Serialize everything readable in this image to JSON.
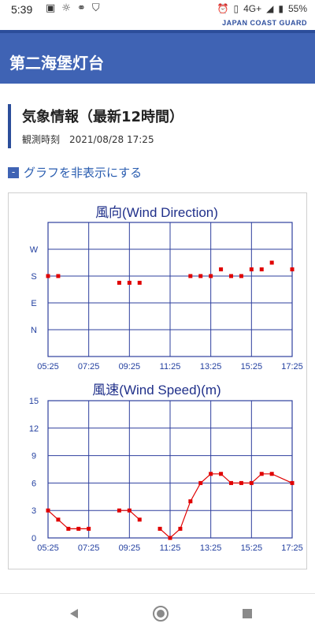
{
  "status_bar": {
    "time": "5:39",
    "network": "4G+",
    "battery": "55%",
    "icons": [
      "image-icon",
      "bulb-icon",
      "link-icon",
      "shield-icon",
      "alarm-icon",
      "vibrate-icon",
      "signal-icon",
      "battery-icon"
    ]
  },
  "header": {
    "org_text": "JAPAN COAST GUARD",
    "title": "第二海堡灯台",
    "colors": {
      "bar": "#3f63b4",
      "accent": "#2b4d9a"
    }
  },
  "section": {
    "title": "気象情報（最新12時間）",
    "obs_label": "観測時刻",
    "obs_time": "2021/08/28 17:25"
  },
  "toggle": {
    "box": "-",
    "label": "グラフを非表示にする"
  },
  "chart_data": [
    {
      "type": "scatter",
      "title": "風向(Wind Direction)",
      "x_ticks": [
        "05:25",
        "07:25",
        "09:25",
        "11:25",
        "13:25",
        "15:25",
        "17:25"
      ],
      "y_ticks": [
        "N",
        "E",
        "S",
        "W"
      ],
      "xlim": [
        0,
        12
      ],
      "ylim": [
        -1,
        4
      ],
      "y_scale": "N=0, E=1, S=2, W=3 (16-point, 0.25 per step)",
      "points": [
        {
          "x": 0.0,
          "y": 2.0
        },
        {
          "x": 0.5,
          "y": 2.0
        },
        {
          "x": 3.5,
          "y": 1.75
        },
        {
          "x": 4.0,
          "y": 1.75
        },
        {
          "x": 4.5,
          "y": 1.75
        },
        {
          "x": 7.0,
          "y": 2.0
        },
        {
          "x": 7.5,
          "y": 2.0
        },
        {
          "x": 8.0,
          "y": 2.0
        },
        {
          "x": 8.5,
          "y": 2.25
        },
        {
          "x": 9.0,
          "y": 2.0
        },
        {
          "x": 9.5,
          "y": 2.0
        },
        {
          "x": 10.0,
          "y": 2.25
        },
        {
          "x": 10.5,
          "y": 2.25
        },
        {
          "x": 11.0,
          "y": 2.5
        },
        {
          "x": 12.0,
          "y": 2.25
        }
      ],
      "color": "#e00000",
      "grid": true
    },
    {
      "type": "line",
      "title": "風速(Wind Speed)(m)",
      "x_ticks": [
        "05:25",
        "07:25",
        "09:25",
        "11:25",
        "13:25",
        "15:25",
        "17:25"
      ],
      "y_ticks": [
        "0",
        "3",
        "6",
        "9",
        "12",
        "15"
      ],
      "xlim": [
        0,
        12
      ],
      "ylim": [
        0,
        15
      ],
      "segments": [
        [
          {
            "x": 0.0,
            "y": 3
          },
          {
            "x": 0.5,
            "y": 2
          },
          {
            "x": 1.0,
            "y": 1
          },
          {
            "x": 1.5,
            "y": 1
          },
          {
            "x": 2.0,
            "y": 1
          }
        ],
        [
          {
            "x": 3.5,
            "y": 3
          },
          {
            "x": 4.0,
            "y": 3
          },
          {
            "x": 4.5,
            "y": 2
          }
        ],
        [
          {
            "x": 5.5,
            "y": 1
          },
          {
            "x": 6.0,
            "y": 0
          },
          {
            "x": 6.5,
            "y": 1
          },
          {
            "x": 7.0,
            "y": 4
          },
          {
            "x": 7.5,
            "y": 6
          },
          {
            "x": 8.0,
            "y": 7
          },
          {
            "x": 8.5,
            "y": 7
          },
          {
            "x": 9.0,
            "y": 6
          },
          {
            "x": 9.5,
            "y": 6
          },
          {
            "x": 10.0,
            "y": 6
          },
          {
            "x": 10.5,
            "y": 7
          },
          {
            "x": 11.0,
            "y": 7
          },
          {
            "x": 12.0,
            "y": 6
          }
        ]
      ],
      "color": "#e00000",
      "grid": true
    }
  ],
  "nav": {
    "buttons": [
      "back-icon",
      "home-icon",
      "recents-icon"
    ]
  }
}
